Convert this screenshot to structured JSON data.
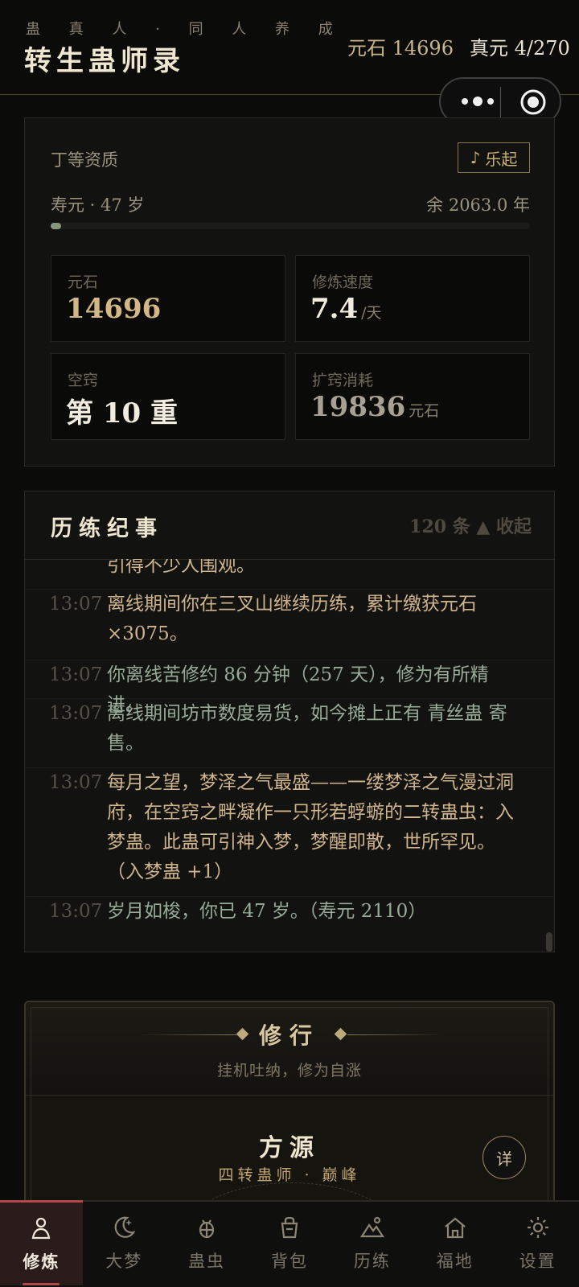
{
  "header": {
    "subtitle": "蛊 真 人 · 同 人 养 成",
    "title": "转生蛊师录",
    "yuanshi": "元石 14696",
    "zhenyuan": "真元 4/270"
  },
  "status": {
    "grade": "丁等资质",
    "music_icon": "♪",
    "music_label": "乐起",
    "lifespan": "寿元 · 47 岁",
    "remaining": "余 2063.0 年",
    "life_progress": 0.022,
    "cells": {
      "yuanshi_label": "元石",
      "yuanshi_value": "14696",
      "speed_label": "修炼速度",
      "speed_value": "7.4",
      "speed_unit": "/天",
      "aperture_label": "空窍",
      "aperture_value": "第 10 重",
      "expand_label": "扩窍消耗",
      "expand_value": "19836",
      "expand_unit": "元石"
    }
  },
  "log": {
    "title": "历练纪事",
    "meta": "120 条 ▲ 收起",
    "entries": [
      {
        "time": "",
        "text": "引得不少人围观。",
        "tone": "gold"
      },
      {
        "time": "13:07",
        "text": "离线期间你在三叉山继续历练，累计缴获元石×3075。",
        "tone": "gold"
      },
      {
        "time": "13:07",
        "text": "你离线苦修约 86 分钟（257 天），修为有所精进。",
        "tone": "green"
      },
      {
        "time": "13:07",
        "text": "离线期间坊市数度易货，如今摊上正有 青丝蛊 寄售。",
        "tone": "green"
      },
      {
        "time": "13:07",
        "text": "每月之望，梦泽之气最盛——一缕梦泽之气漫过洞府，在空窍之畔凝作一只形若蜉蝣的二转蛊虫：入梦蛊。此蛊可引神入梦，梦醒即散，世所罕见。（入梦蛊 +1）",
        "tone": "gold"
      },
      {
        "time": "13:07",
        "text": "岁月如梭，你已 47 岁。（寿元 2110）",
        "tone": "green"
      }
    ]
  },
  "cultivation": {
    "title": "修行",
    "subtitle": "挂机吐纳，修为自涨",
    "source_name": "方源",
    "source_rank": "四转蛊师 · 巅峰",
    "detail_label": "详"
  },
  "tabs": [
    {
      "label": "修炼",
      "icon": "person-icon",
      "active": true
    },
    {
      "label": "大梦",
      "icon": "moon-icon",
      "active": false
    },
    {
      "label": "蛊虫",
      "icon": "bug-icon",
      "active": false
    },
    {
      "label": "背包",
      "icon": "bag-icon",
      "active": false
    },
    {
      "label": "历练",
      "icon": "mountain-icon",
      "active": false
    },
    {
      "label": "福地",
      "icon": "home-icon",
      "active": false
    },
    {
      "label": "设置",
      "icon": "gear-icon",
      "active": false
    }
  ]
}
